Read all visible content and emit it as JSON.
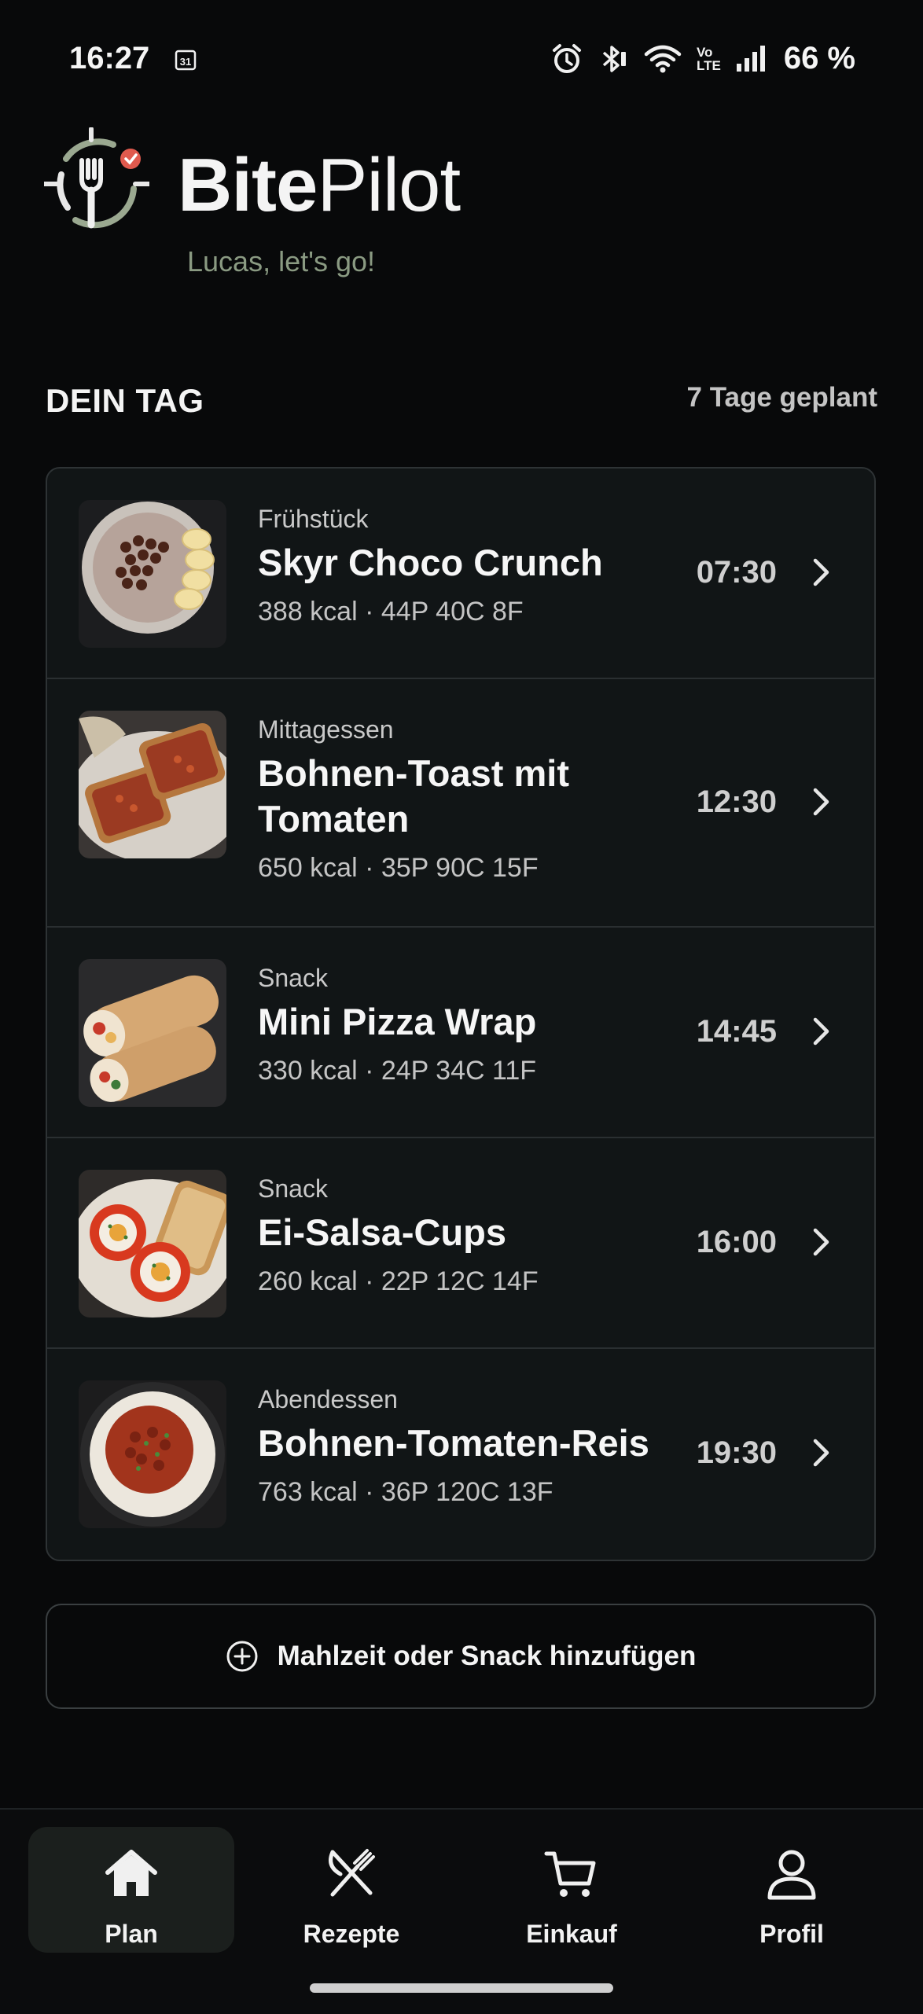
{
  "status_bar": {
    "time": "16:27",
    "calendar_day": "31",
    "volte_line1": "Vo",
    "volte_line2": "LTE",
    "battery": "66 %",
    "icons": [
      "alarm-icon",
      "bluetooth-icon",
      "wifi-icon",
      "volte-icon",
      "signal-icon"
    ]
  },
  "header": {
    "app_name_bold": "Bite",
    "app_name_light": "Pilot",
    "greeting": "Lucas, let's go!"
  },
  "section": {
    "title": "DEIN TAG",
    "planned": "7 Tage geplant"
  },
  "meals": [
    {
      "type": "Frühstück",
      "name_lines": [
        "Skyr Choco Crunch"
      ],
      "macros": "388 kcal · 44P 40C 8F",
      "time": "07:30",
      "image": "skyr-bowl-image"
    },
    {
      "type": "Mittagessen",
      "name_lines": [
        "Bohnen-Toast mit",
        "Tomaten"
      ],
      "macros": "650 kcal · 35P 90C 15F",
      "time": "12:30",
      "image": "bean-toast-image"
    },
    {
      "type": "Snack",
      "name_lines": [
        "Mini Pizza Wrap"
      ],
      "macros": "330 kcal · 24P 34C 11F",
      "time": "14:45",
      "image": "pizza-wrap-image"
    },
    {
      "type": "Snack",
      "name_lines": [
        "Ei-Salsa-Cups"
      ],
      "macros": "260 kcal · 22P 12C 14F",
      "time": "16:00",
      "image": "egg-salsa-cups-image"
    },
    {
      "type": "Abendessen",
      "name_lines": [
        "Bohnen-Tomaten-Reis"
      ],
      "macros": "763 kcal · 36P 120C 13F",
      "time": "19:30",
      "image": "bean-tomato-rice-image"
    }
  ],
  "add_button": {
    "label": "Mahlzeit oder Snack hinzufügen",
    "icon": "plus-circle-icon"
  },
  "nav": [
    {
      "label": "Plan",
      "icon": "home-icon",
      "active": true
    },
    {
      "label": "Rezepte",
      "icon": "utensils-icon",
      "active": false
    },
    {
      "label": "Einkauf",
      "icon": "cart-icon",
      "active": false
    },
    {
      "label": "Profil",
      "icon": "person-icon",
      "active": false
    }
  ],
  "colors": {
    "background": "#08090a",
    "card": "#111516",
    "accent_green": "#8a9a82",
    "logo_red": "#e05a4e"
  }
}
